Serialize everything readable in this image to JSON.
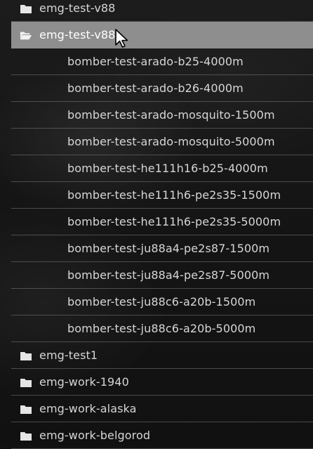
{
  "colors": {
    "text": "#d6d6d6",
    "selected_bg": "#8e8e8e",
    "selected_text": "#ffffff",
    "divider": "#787878",
    "folder_icon": "#e6e6e6"
  },
  "tree": {
    "folder_top": {
      "label": "emg-test-v88",
      "icon": "folder-icon"
    },
    "folder_open": {
      "label": "emg-test-v88",
      "icon": "folder-open-icon",
      "selected": true
    },
    "children": [
      "bomber-test-arado-b25-4000m",
      "bomber-test-arado-b26-4000m",
      "bomber-test-arado-mosquito-1500m",
      "bomber-test-arado-mosquito-5000m",
      "bomber-test-he111h16-b25-4000m",
      "bomber-test-he111h6-pe2s35-1500m",
      "bomber-test-he111h6-pe2s35-5000m",
      "bomber-test-ju88a4-pe2s87-1500m",
      "bomber-test-ju88a4-pe2s87-5000m",
      "bomber-test-ju88c6-a20b-1500m",
      "bomber-test-ju88c6-a20b-5000m"
    ],
    "folders_after": [
      "emg-test1",
      "emg-work-1940",
      "emg-work-alaska",
      "emg-work-belgorod"
    ]
  }
}
